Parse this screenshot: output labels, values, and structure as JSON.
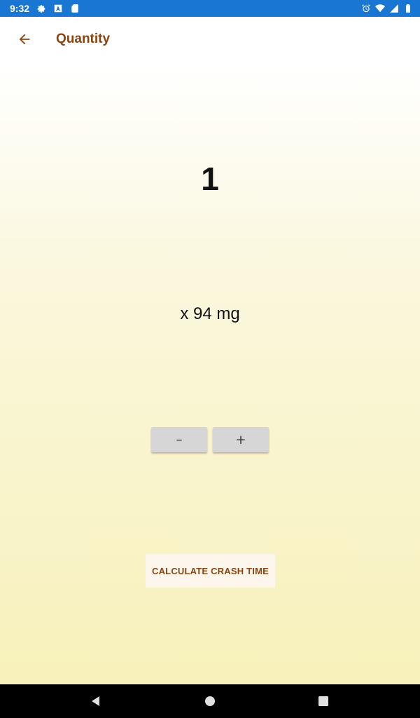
{
  "status_bar": {
    "time": "9:32",
    "left_icons": [
      "settings-icon",
      "a-badge-icon",
      "sd-card-icon"
    ],
    "right_icons": [
      "alarm-icon",
      "wifi-icon",
      "signal-icon",
      "battery-icon"
    ]
  },
  "app_bar": {
    "back_icon": "arrow-back-icon",
    "title": "Quantity"
  },
  "main": {
    "quantity": "1",
    "dose": "x 94 mg",
    "decrement_label": "–",
    "increment_label": "+",
    "calculate_label": "CALCULATE CRASH TIME"
  },
  "nav_bar": {
    "icons": [
      "back-triangle-icon",
      "home-circle-icon",
      "recents-square-icon"
    ]
  },
  "colors": {
    "status_bar": "#1976d2",
    "accent": "#8b4513",
    "gradient_top": "#ffffff",
    "gradient_bottom": "#f8f1bb",
    "stepper_button": "#d6d6d6",
    "calculate_button": "#fcf6ec"
  }
}
